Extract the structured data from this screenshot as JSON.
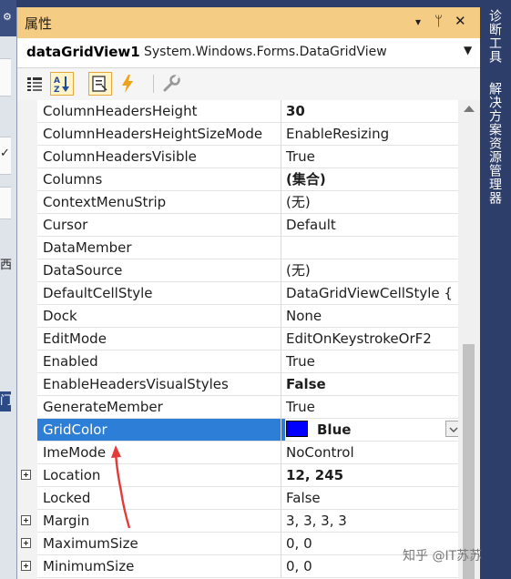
{
  "left_strip": {
    "icon": "⚙",
    "chars": [
      "✓",
      "西",
      "门"
    ]
  },
  "panel": {
    "title": "属性",
    "buttons": {
      "pin": "▾",
      "autohide": "ᛘ",
      "close": "✕"
    },
    "object_name": "dataGridView1",
    "object_type": "System.Windows.Forms.DataGridView",
    "object_dropdown": "▼"
  },
  "toolbar": {
    "buttons": [
      "categorized",
      "alphabetical",
      "properties",
      "events",
      "property-pages"
    ],
    "selected": [
      "alphabetical",
      "properties"
    ]
  },
  "properties": [
    {
      "name": "ColumnHeadersHeight",
      "value": "30",
      "bold": true,
      "expandable": false
    },
    {
      "name": "ColumnHeadersHeightSizeMode",
      "value": "EnableResizing",
      "bold": false,
      "expandable": false
    },
    {
      "name": "ColumnHeadersVisible",
      "value": "True",
      "bold": false,
      "expandable": false
    },
    {
      "name": "Columns",
      "value": "(集合)",
      "bold": true,
      "expandable": false
    },
    {
      "name": "ContextMenuStrip",
      "value": "(无)",
      "bold": false,
      "expandable": false
    },
    {
      "name": "Cursor",
      "value": "Default",
      "bold": false,
      "expandable": false
    },
    {
      "name": "DataMember",
      "value": "",
      "bold": false,
      "expandable": false
    },
    {
      "name": "DataSource",
      "value": "(无)",
      "bold": false,
      "expandable": false
    },
    {
      "name": "DefaultCellStyle",
      "value": "DataGridViewCellStyle { B",
      "bold": false,
      "expandable": false
    },
    {
      "name": "Dock",
      "value": "None",
      "bold": false,
      "expandable": false
    },
    {
      "name": "EditMode",
      "value": "EditOnKeystrokeOrF2",
      "bold": false,
      "expandable": false
    },
    {
      "name": "Enabled",
      "value": "True",
      "bold": false,
      "expandable": false
    },
    {
      "name": "EnableHeadersVisualStyles",
      "value": "False",
      "bold": true,
      "expandable": false
    },
    {
      "name": "GenerateMember",
      "value": "True",
      "bold": false,
      "expandable": false
    },
    {
      "name": "GridColor",
      "value": "Blue",
      "bold": true,
      "expandable": false,
      "selected": true,
      "swatch": "#0000ff"
    },
    {
      "name": "ImeMode",
      "value": "NoControl",
      "bold": false,
      "expandable": false
    },
    {
      "name": "Location",
      "value": "12, 245",
      "bold": true,
      "expandable": true
    },
    {
      "name": "Locked",
      "value": "False",
      "bold": false,
      "expandable": false
    },
    {
      "name": "Margin",
      "value": "3, 3, 3, 3",
      "bold": false,
      "expandable": true
    },
    {
      "name": "MaximumSize",
      "value": "0, 0",
      "bold": false,
      "expandable": true
    },
    {
      "name": "MinimumSize",
      "value": "0, 0",
      "bold": false,
      "expandable": true
    }
  ],
  "right_tabs": [
    "诊断工具",
    "解决方案资源管理器"
  ],
  "watermark": "知乎 @IT苏苏",
  "colors": {
    "selection": "#2d7ed6",
    "titlebar": "#f5cc84",
    "annotation_arrow": "#e53a3a"
  }
}
